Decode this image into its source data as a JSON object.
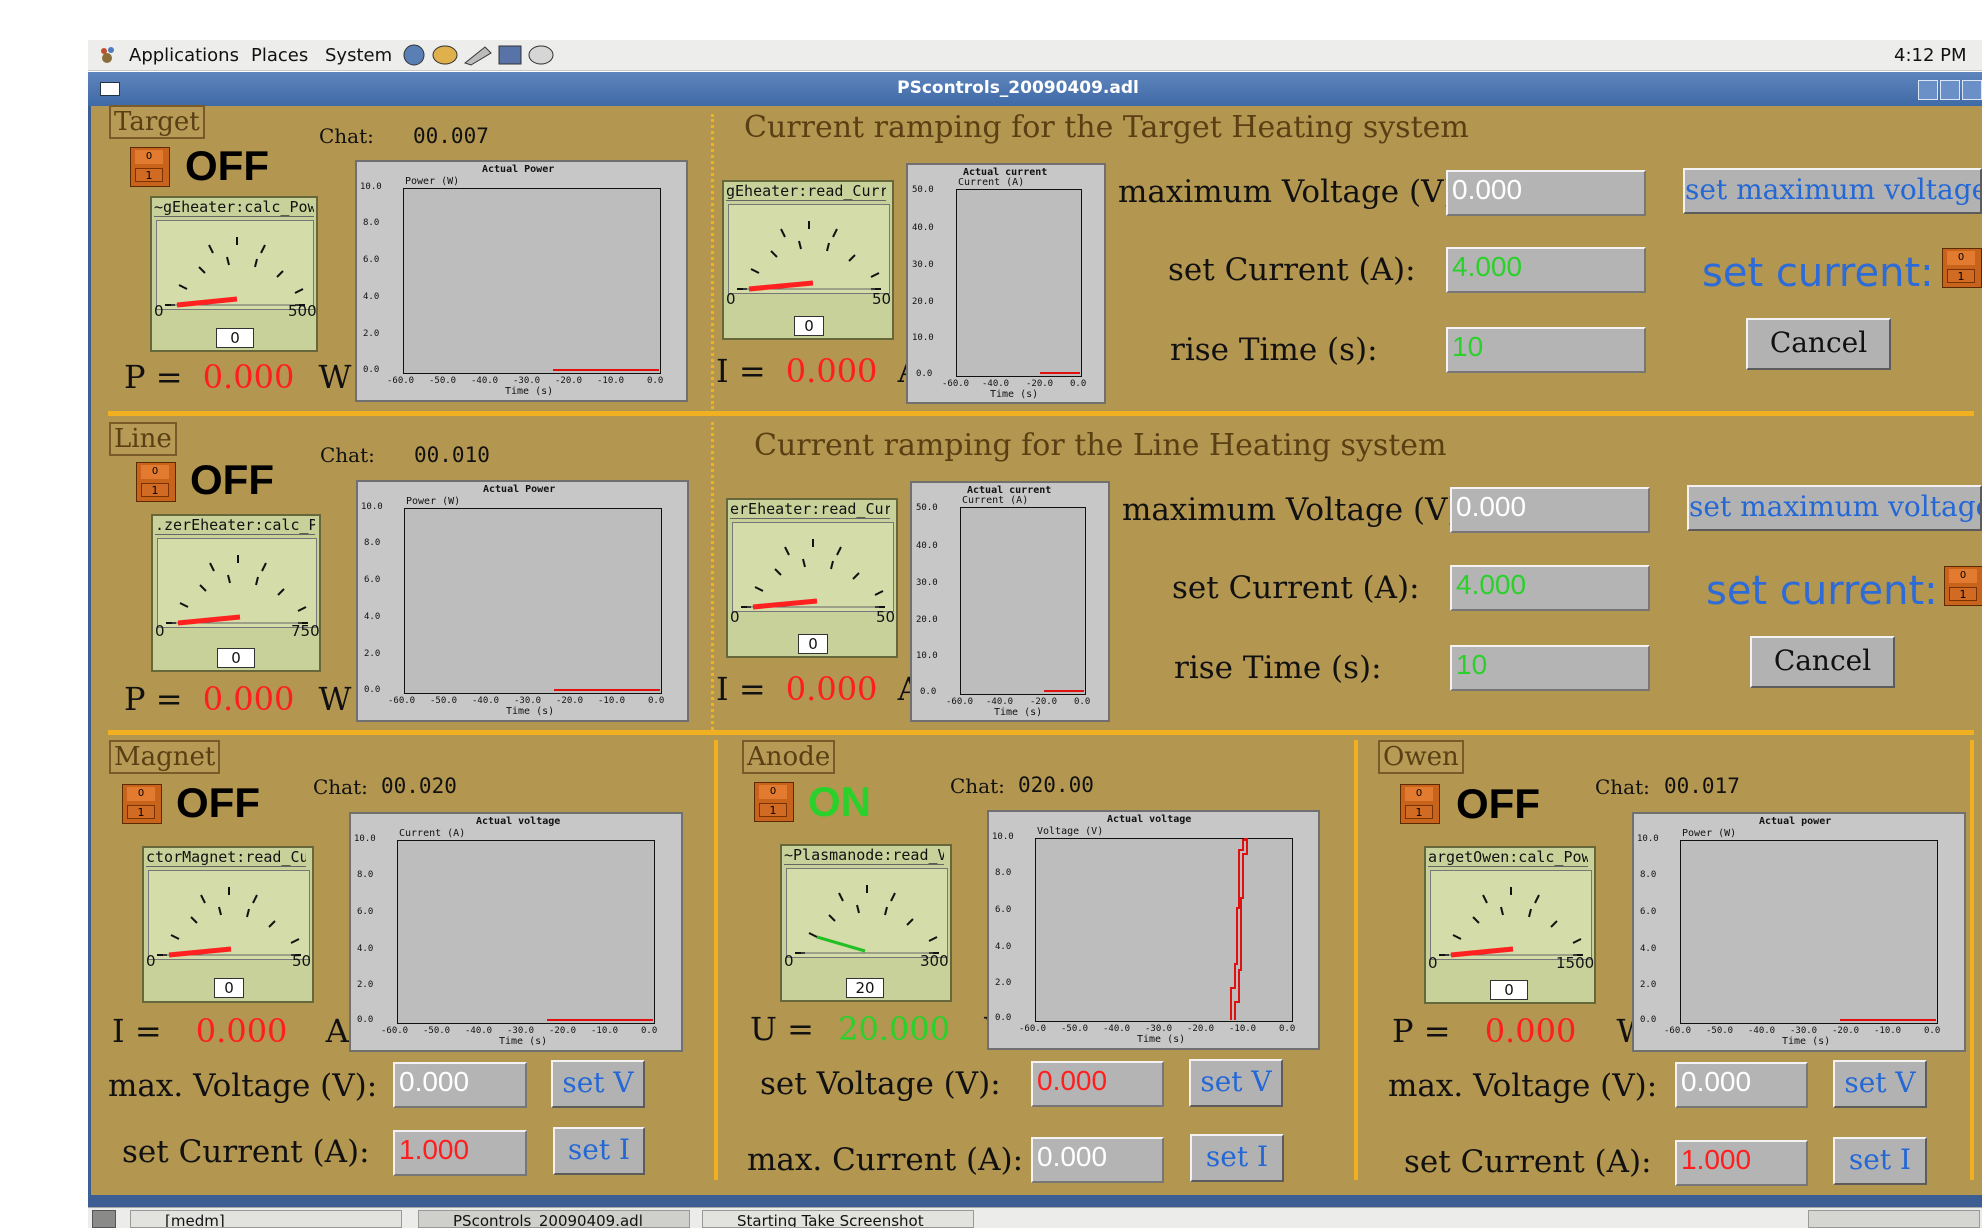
{
  "topbar": {
    "menus": [
      "Applications",
      "Places",
      "System"
    ],
    "clock": "4:12 PM"
  },
  "window": {
    "title": "PScontrols_20090409.adl"
  },
  "target": {
    "label": "Target",
    "chat_label": "Chat:",
    "chat_value": "00.007",
    "state": "OFF",
    "toggle_top": "0",
    "toggle_bottom": "1",
    "meter_pv": "~gEheater:calc_Pow",
    "meter_min": "0",
    "meter_max": "500",
    "meter_readout": "0",
    "power_plot": {
      "title": "Actual Power",
      "ylabel": "Power (W)",
      "xlabel": "Time (s)"
    },
    "value_prefix": "P =",
    "value": "0.000",
    "unit": "W",
    "ramp_title": "Current ramping for the Target Heating system",
    "current_meter_pv": "gEheater:read_Curr",
    "current_meter_min": "0",
    "current_meter_max": "50",
    "current_meter_readout": "0",
    "current_prefix": "I =",
    "current_value": "0.000",
    "current_unit": "A",
    "current_plot": {
      "title": "Actual current",
      "ylabel": "Current (A)",
      "xlabel": "Time (s)"
    },
    "max_voltage_label": "maximum Voltage (V):",
    "max_voltage_value": "0.000",
    "set_max_voltage_button": "set maximum voltage",
    "set_current_label": "set Current (A):",
    "set_current_value": "4.000",
    "set_current_big": "set current:",
    "rise_time_label": "rise Time (s):",
    "rise_time_value": "10",
    "cancel": "Cancel"
  },
  "line": {
    "label": "Line",
    "chat_label": "Chat:",
    "chat_value": "00.010",
    "state": "OFF",
    "toggle_top": "0",
    "toggle_bottom": "1",
    "meter_pv": ".zerEheater:calc_Po",
    "meter_min": "0",
    "meter_max": "750",
    "meter_readout": "0",
    "power_plot": {
      "title": "Actual Power",
      "ylabel": "Power (W)",
      "xlabel": "Time (s)"
    },
    "value_prefix": "P =",
    "value": "0.000",
    "unit": "W",
    "ramp_title": "Current ramping for the Line Heating system",
    "current_meter_pv": "erEheater:read_Cur",
    "current_meter_min": "0",
    "current_meter_max": "50",
    "current_meter_readout": "0",
    "current_prefix": "I =",
    "current_value": "0.000",
    "current_unit": "A",
    "current_plot": {
      "title": "Actual current",
      "ylabel": "Current (A)",
      "xlabel": "Time (s)"
    },
    "max_voltage_label": "maximum Voltage (V):",
    "max_voltage_value": "0.000",
    "set_max_voltage_button": "set maximum voltage",
    "set_current_label": "set Current (A):",
    "set_current_value": "4.000",
    "set_current_big": "set current:",
    "rise_time_label": "rise Time (s):",
    "rise_time_value": "10",
    "cancel": "Cancel"
  },
  "magnet": {
    "label": "Magnet",
    "chat_label": "Chat:",
    "chat_value": "00.020",
    "state": "OFF",
    "toggle_top": "0",
    "toggle_bottom": "1",
    "meter_pv": "ctorMagnet:read_Cu",
    "meter_min": "0",
    "meter_max": "50",
    "meter_readout": "0",
    "plot": {
      "title": "Actual voltage",
      "ylabel": "Current (A)",
      "xlabel": "Time (s)"
    },
    "value_prefix": "I =",
    "value": "0.000",
    "unit": "A",
    "row1_label": "max. Voltage (V):",
    "row1_value": "0.000",
    "row1_button": "set V",
    "row2_label": "set Current (A):",
    "row2_value": "1.000",
    "row2_button": "set I"
  },
  "anode": {
    "label": "Anode",
    "chat_label": "Chat:",
    "chat_value": "020.00",
    "state": "ON",
    "toggle_top": "0",
    "toggle_bottom": "1",
    "meter_pv": "~Plasmanode:read_V",
    "meter_min": "0",
    "meter_max": "300",
    "meter_readout": "20",
    "plot": {
      "title": "Actual voltage",
      "ylabel": "Voltage (V)",
      "xlabel": "Time (s)"
    },
    "value_prefix": "U =",
    "value": "20.000",
    "unit": "V",
    "row1_label": "set Voltage (V):",
    "row1_value": "0.000",
    "row1_button": "set V",
    "row2_label": "max. Current (A):",
    "row2_value": "0.000",
    "row2_button": "set I"
  },
  "owen": {
    "label": "Owen",
    "chat_label": "Chat:",
    "chat_value": "00.017",
    "state": "OFF",
    "toggle_top": "0",
    "toggle_bottom": "1",
    "meter_pv": "argetOwen:calc_Powe",
    "meter_min": "0",
    "meter_max": "1500",
    "meter_readout": "0",
    "plot": {
      "title": "Actual power",
      "ylabel": "Power (W)",
      "xlabel": "Time (s)"
    },
    "value_prefix": "P =",
    "value": "0.000",
    "unit": "W",
    "row1_label": "max. Voltage (V):",
    "row1_value": "0.000",
    "row1_button": "set V",
    "row2_label": "set Current (A):",
    "row2_value": "1.000",
    "row2_button": "set I"
  },
  "plot_ticks": {
    "x": [
      "-60.0",
      "-50.0",
      "-40.0",
      "-30.0",
      "-20.0",
      "-10.0",
      "0.0"
    ],
    "y10": [
      "10.0",
      "8.0",
      "6.0",
      "4.0",
      "2.0",
      "0.0"
    ],
    "y50": [
      "50.0",
      "40.0",
      "30.0",
      "20.0",
      "10.0",
      "0.0"
    ]
  },
  "taskbar": {
    "items": [
      "[medm]",
      "PScontrols_20090409.adl",
      "Starting Take Screenshot"
    ]
  },
  "colors": {
    "panel_bg": "#b3964f",
    "separator": "#f0b020",
    "alarm_red": "#ff1e1e",
    "ok_green": "#2ad12a",
    "button_text_blue": "#2468d6"
  }
}
